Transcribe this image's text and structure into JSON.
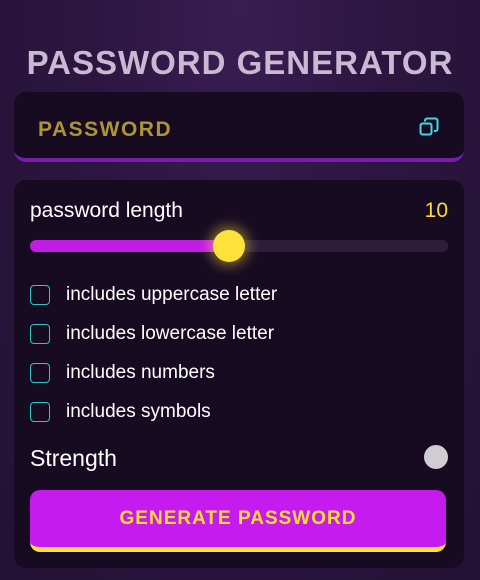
{
  "app": {
    "title": "PASSWORD GENERATOR"
  },
  "password": {
    "display": "PASSWORD",
    "copy_icon": "copy-icon"
  },
  "length": {
    "label": "password length",
    "value": "10",
    "min": 1,
    "max": 20,
    "fill_fraction": 0.475
  },
  "options": [
    {
      "label": "includes uppercase letter",
      "checked": false
    },
    {
      "label": "includes lowercase letter",
      "checked": false
    },
    {
      "label": "includes numbers",
      "checked": false
    },
    {
      "label": "includes symbols",
      "checked": false
    }
  ],
  "strength": {
    "label": "Strength",
    "indicator_color": "#cfcdd2"
  },
  "generate": {
    "label": "GENERATE PASSWORD"
  },
  "colors": {
    "accent": "#c51bef",
    "highlight": "#ffe13b",
    "checkbox_border": "#2fc6c6",
    "title": "#c9b9d3"
  }
}
